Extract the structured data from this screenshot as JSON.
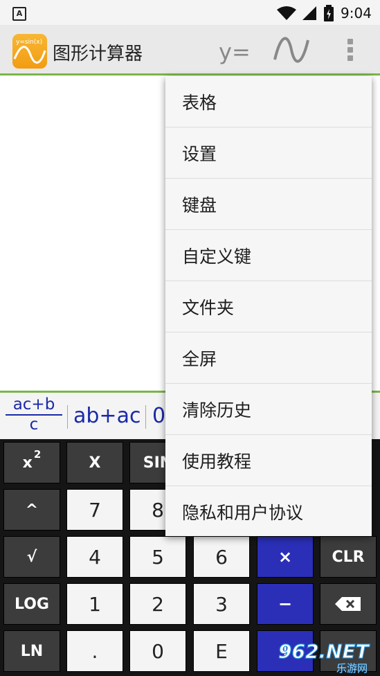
{
  "status_bar": {
    "time": "9:04",
    "notification_icon": "A"
  },
  "app_bar": {
    "title": "图形计算器",
    "logo_text": "y=sin(x)",
    "y_equals_label": "y=",
    "wave_icon": "graph-icon",
    "overflow_icon": "more-vert-icon"
  },
  "suggestions": {
    "fraction_numerator": "ac+b",
    "fraction_denominator": "c",
    "item2": "ab+ac",
    "item3": "0"
  },
  "keypad": {
    "row1": [
      "x",
      "X",
      "SIN"
    ],
    "row1_superscript": "2",
    "row2": [
      "^",
      "7",
      "8"
    ],
    "row3": [
      "√",
      "4",
      "5",
      "6",
      "×",
      "CLR"
    ],
    "row4": [
      "LOG",
      "1",
      "2",
      "3",
      "−",
      "⌫"
    ],
    "row5": [
      "LN",
      ".",
      "0",
      "E",
      "+"
    ]
  },
  "menu": {
    "items": [
      "表格",
      "设置",
      "键盘",
      "自定义键",
      "文件夹",
      "全屏",
      "清除历史",
      "使用教程",
      "隐私和用户协议"
    ]
  },
  "watermark": {
    "text": "962.NET",
    "subtext": "乐游网"
  },
  "colors": {
    "accent_green": "#7ab648",
    "key_blue": "#2b2fb8",
    "key_dark": "#3c3c3c",
    "suggestion_blue": "#1a2aa8"
  }
}
